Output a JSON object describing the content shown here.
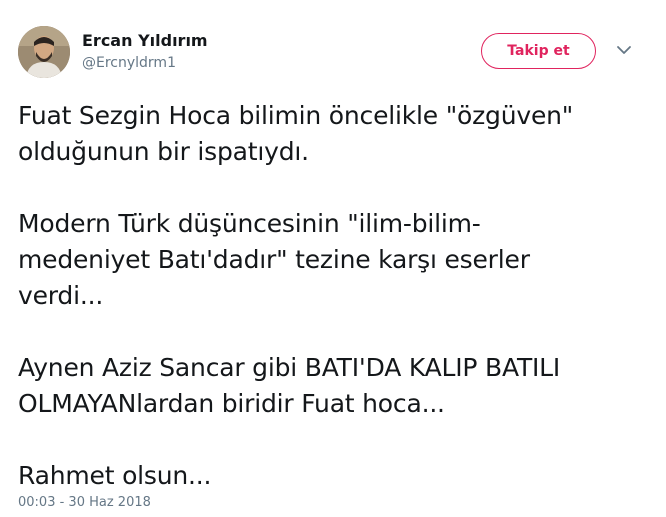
{
  "author": {
    "display_name": "Ercan Yıldırım",
    "handle": "@Ercnyldrm1"
  },
  "follow_button": {
    "label": "Takip et",
    "color": "#e0245e"
  },
  "menu_icon": "chevron-down-icon",
  "tweet": {
    "paragraphs": [
      [
        "Fuat Sezgin Hoca bilimin öncelikle \"özgüven\"",
        "olduğunun bir ispatıydı."
      ],
      [
        "Modern Türk düşüncesinin \"ilim-bilim-",
        "medeniyet Batı'dadır\" tezine karşı eserler",
        "verdi..."
      ],
      [
        "Aynen Aziz Sancar gibi BATI'DA KALIP BATILI",
        "OLMAYANlardan biridir Fuat hoca..."
      ],
      [
        "Rahmet olsun..."
      ]
    ]
  },
  "timestamp": "00:03 - 30 Haz 2018",
  "colors": {
    "text": "#14171a",
    "secondary": "#657786"
  }
}
